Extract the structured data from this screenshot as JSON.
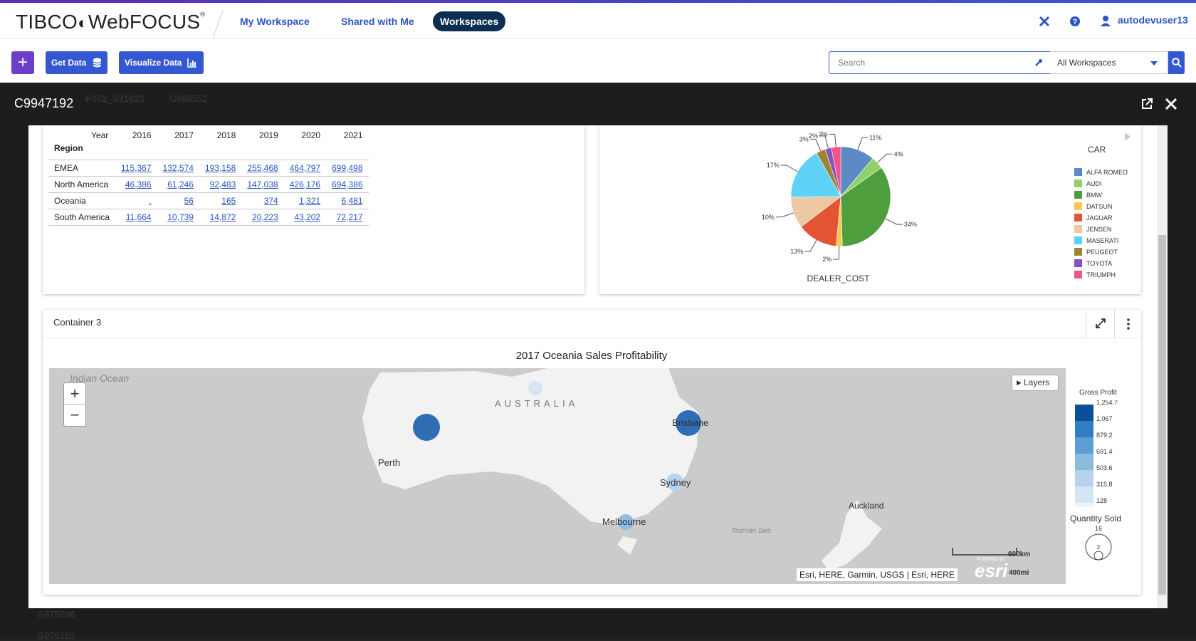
{
  "header": {
    "brand": "TIBCO",
    "brand_product": "WebFOCUS",
    "trademark": "®",
    "nav": [
      "My Workspace",
      "Shared with Me",
      "Workspaces"
    ],
    "active_nav": "Workspaces",
    "user": "autodevuser13"
  },
  "toolbar": {
    "get_data": "Get Data",
    "visualize": "Visualize Data",
    "search_placeholder": "Search",
    "workspace_select": "All Workspaces"
  },
  "background": {
    "breadcrumb": [
      "P452_S31923",
      "G866552"
    ],
    "items": [
      "G875096",
      "G975110"
    ]
  },
  "dialog": {
    "title": "C9947192"
  },
  "table": {
    "col_header_label": "Year",
    "row_header_label": "Region",
    "years": [
      "2016",
      "2017",
      "2018",
      "2019",
      "2020",
      "2021"
    ],
    "rows": [
      {
        "region": "EMEA",
        "values": [
          "115,367",
          "132,574",
          "193,158",
          "255,468",
          "464,797",
          "699,498"
        ]
      },
      {
        "region": "North America",
        "values": [
          "46,386",
          "61,246",
          "92,483",
          "147,038",
          "426,176",
          "694,386"
        ]
      },
      {
        "region": "Oceania",
        "values": [
          ".",
          "56",
          "165",
          "374",
          "1,321",
          "6,481"
        ]
      },
      {
        "region": "South America",
        "values": [
          "11,664",
          "10,739",
          "14,872",
          "20,223",
          "43,202",
          "72,217"
        ]
      }
    ]
  },
  "chart_data": {
    "type": "pie",
    "title": "",
    "xlabel": "DEALER_COST",
    "legend_title": "CAR",
    "legend_position": "right",
    "slices": [
      {
        "label": "ALFA ROMEO",
        "value": 11,
        "pct": "11%",
        "color": "#5b8ac5"
      },
      {
        "label": "AUDI",
        "value": 4,
        "pct": "4%",
        "color": "#91d16b"
      },
      {
        "label": "BMW",
        "value": 34,
        "pct": "34%",
        "color": "#4e9e3e"
      },
      {
        "label": "DATSUN",
        "value": 2,
        "pct": "2%",
        "color": "#f9c84d"
      },
      {
        "label": "JAGUAR",
        "value": 13,
        "pct": "13%",
        "color": "#e55432"
      },
      {
        "label": "JENSEN",
        "value": 10,
        "pct": "10%",
        "color": "#ecc9a2"
      },
      {
        "label": "MASERATI",
        "value": 17,
        "pct": "17%",
        "color": "#5ed2f7"
      },
      {
        "label": "PEUGEOT",
        "value": 3,
        "pct": "3%",
        "color": "#9c8534"
      },
      {
        "label": "TOYOTA",
        "value": 2,
        "pct": "2%",
        "color": "#8452c2"
      },
      {
        "label": "TRIUMPH",
        "value": 3,
        "pct": "3%",
        "color": "#f25487"
      }
    ]
  },
  "container3": {
    "title": "Container 3"
  },
  "map": {
    "title": "2017 Oceania Sales Profitability",
    "layers_label": "Layers",
    "ocean_label": "Indian Ocean",
    "country_label": "AUSTRALIA",
    "sea_label": "Tasman Sea",
    "cities": [
      "Perth",
      "Brisbane",
      "Sydney",
      "Melbourne",
      "Auckland"
    ],
    "scale_km": "600km",
    "scale_mi": "400mi",
    "attribution": "Esri, HERE, Garmin, USGS | Esri, HERE",
    "powered": "POWERED BY",
    "esri": "esri",
    "legend_gp_title": "Gross Profit",
    "legend_gp_values": [
      "1,254.7",
      "1,067",
      "879.2",
      "691.4",
      "503.6",
      "315.8",
      "128"
    ],
    "legend_gp_colors": [
      "#0b4f9a",
      "#2f7ec2",
      "#5d9fd3",
      "#8cbbe0",
      "#b5d3ec",
      "#d5e5f4",
      "#eef4fb"
    ],
    "legend_qty_title": "Quantity Sold",
    "legend_qty_values": [
      "16",
      "2"
    ]
  }
}
